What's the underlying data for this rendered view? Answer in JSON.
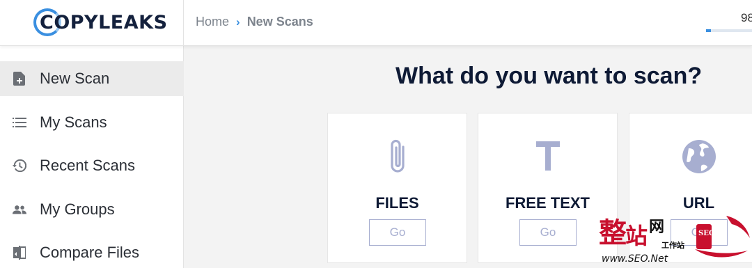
{
  "header": {
    "logo_text": "COPYLEAKS",
    "breadcrumb": {
      "home": "Home",
      "separator": "›",
      "current": "New Scans"
    },
    "credits_value": "98",
    "credits_progress": 0.1
  },
  "sidebar": {
    "items": [
      {
        "label": "New Scan",
        "icon": "new-scan-icon",
        "active": true
      },
      {
        "label": "My Scans",
        "icon": "list-icon",
        "active": false
      },
      {
        "label": "Recent Scans",
        "icon": "history-icon",
        "active": false
      },
      {
        "label": "My Groups",
        "icon": "groups-icon",
        "active": false
      },
      {
        "label": "Compare Files",
        "icon": "compare-icon",
        "active": false
      }
    ]
  },
  "main": {
    "title": "What do you want to scan?",
    "cards": [
      {
        "title": "FILES",
        "button": "Go",
        "icon": "paperclip-icon"
      },
      {
        "title": "FREE TEXT",
        "button": "Go",
        "icon": "text-icon"
      },
      {
        "title": "URL",
        "button": "Go",
        "icon": "globe-icon"
      }
    ]
  },
  "watermark": {
    "main_chars": "整站网",
    "sub_chars": "工作站",
    "stamp_chars": "SEO",
    "url": "www.SEO.Net"
  },
  "colors": {
    "accent": "#3a8fe0",
    "title": "#0e1a35",
    "icon": "#a7aed0",
    "watermark_red": "#c8102e"
  }
}
